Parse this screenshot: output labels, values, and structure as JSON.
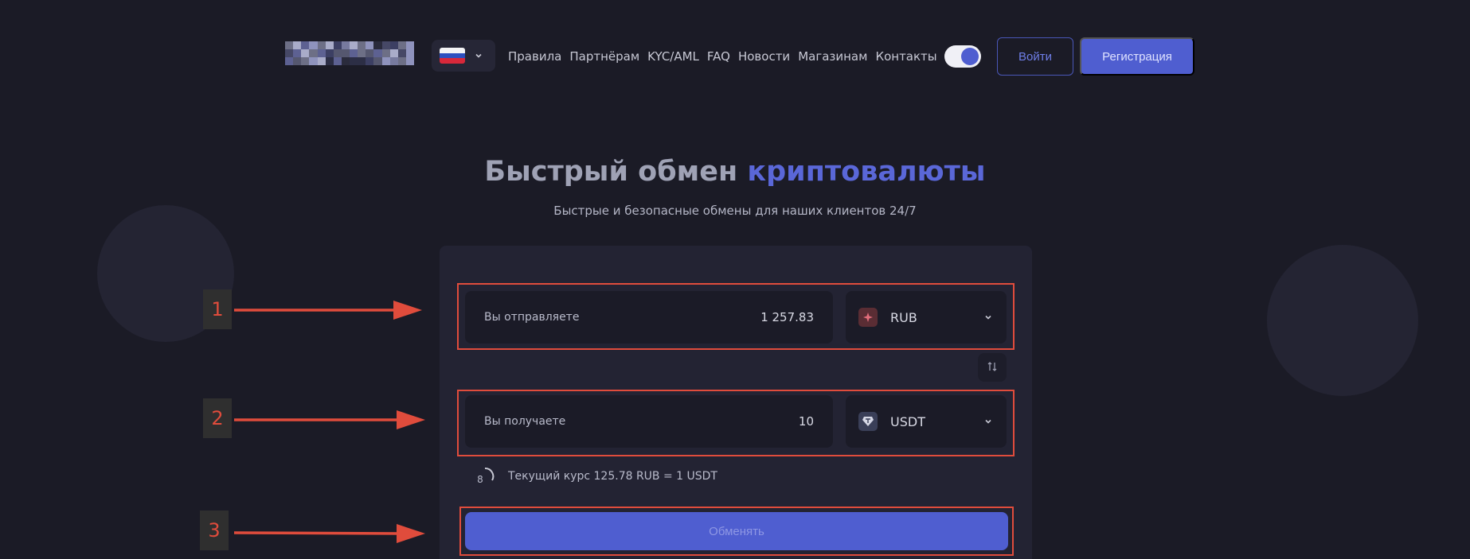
{
  "header": {
    "lang_flag": "russia-flag",
    "nav": [
      "Правила",
      "Партнёрам",
      "KYC/AML",
      "FAQ",
      "Новости",
      "Магазинам",
      "Контакты"
    ],
    "login_label": "Войти",
    "register_label": "Регистрация"
  },
  "hero": {
    "title_main": "Быстрый обмен ",
    "title_accent": "криптовалюты",
    "subtitle": "Быстрые и безопасные обмены для наших клиентов 24/7"
  },
  "exchange": {
    "send_label": "Вы отправляете",
    "send_amount": "1 257.83",
    "send_currency": "RUB",
    "receive_label": "Вы получаете",
    "receive_amount": "10",
    "receive_currency": "USDT",
    "timer_value": "8",
    "rate_text": "Текущий курс 125.78 RUB = 1 USDT",
    "exchange_button": "Обменять"
  },
  "annotations": [
    "1",
    "2",
    "3"
  ],
  "colors": {
    "background": "#1b1b26",
    "accent": "#4f5ed0",
    "highlight": "#e04c3c"
  }
}
